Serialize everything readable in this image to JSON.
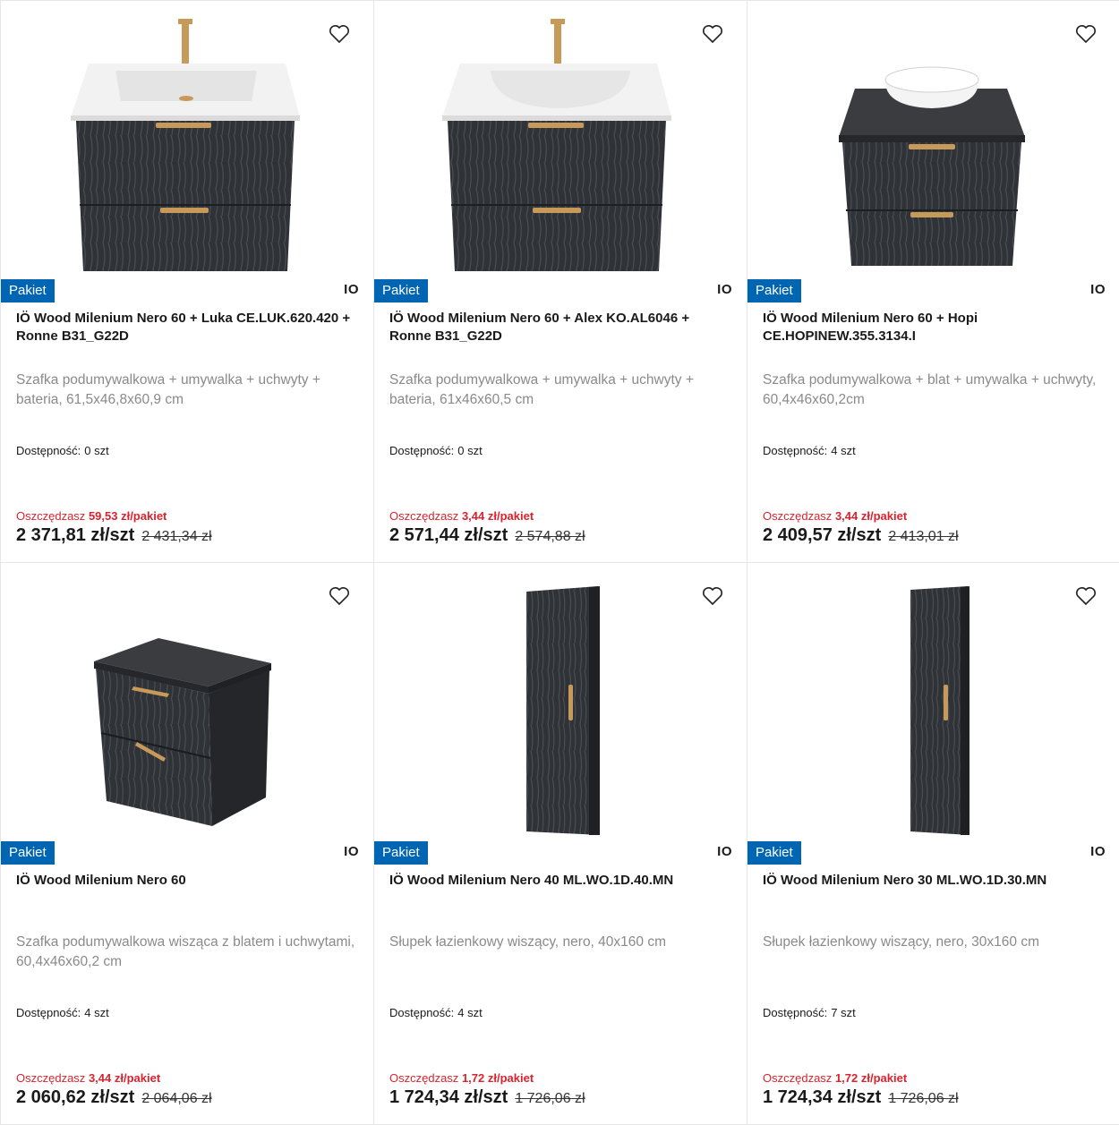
{
  "colors": {
    "badge": "#0066b3",
    "savings": "#d9232d",
    "cabinet": "#2f3236",
    "gold": "#c89a5a"
  },
  "products": [
    {
      "image": "vanity-sink-cabinet",
      "badge": "Pakiet",
      "brand": "IO",
      "title": "IÖ Wood Milenium Nero 60 + Luka CE.LUK.620.420 + Ronne B31_G22D",
      "description": "Szafka podumywalkowa + umywalka + uchwyty + bateria, 61,5x46,8x60,9 cm",
      "availability_label": "Dostępność:",
      "availability_value": "0 szt",
      "save_label": "Oszczędzasz",
      "save_value": "59,53 zł/pakiet",
      "price": "2 371,81 zł/szt",
      "old_price": "2 431,34 zł"
    },
    {
      "image": "vanity-sink-cabinet",
      "badge": "Pakiet",
      "brand": "IO",
      "title": "IÖ Wood Milenium Nero 60 + Alex KO.AL6046 + Ronne B31_G22D",
      "description": "Szafka podumywalkowa + umywalka + uchwyty + bateria, 61x46x60,5 cm",
      "availability_label": "Dostępność:",
      "availability_value": "0 szt",
      "save_label": "Oszczędzasz",
      "save_value": "3,44 zł/pakiet",
      "price": "2 571,44 zł/szt",
      "old_price": "2 574,88 zł"
    },
    {
      "image": "vanity-bowl-cabinet",
      "badge": "Pakiet",
      "brand": "IO",
      "title": "IÖ Wood Milenium Nero 60 + Hopi CE.HOPINEW.355.3134.I",
      "description": "Szafka podumywalkowa + blat + umywalka + uchwyty, 60,4x46x60,2cm",
      "availability_label": "Dostępność:",
      "availability_value": "4 szt",
      "save_label": "Oszczędzasz",
      "save_value": "3,44 zł/pakiet",
      "price": "2 409,57 zł/szt",
      "old_price": "2 413,01 zł"
    },
    {
      "image": "hanging-cabinet",
      "badge": "Pakiet",
      "brand": "IO",
      "title": "IÖ Wood Milenium Nero 60",
      "description": "Szafka podumywalkowa wisząca z blatem i uchwytami, 60,4x46x60,2 cm",
      "availability_label": "Dostępność:",
      "availability_value": "4 szt",
      "save_label": "Oszczędzasz",
      "save_value": "3,44 zł/pakiet",
      "price": "2 060,62 zł/szt",
      "old_price": "2 064,06 zł"
    },
    {
      "image": "tall-column",
      "badge": "Pakiet",
      "brand": "IO",
      "title": "IÖ Wood Milenium Nero 40 ML.WO.1D.40.MN",
      "description": "Słupek łazienkowy wiszący, nero, 40x160 cm",
      "availability_label": "Dostępność:",
      "availability_value": "4 szt",
      "save_label": "Oszczędzasz",
      "save_value": "1,72 zł/pakiet",
      "price": "1 724,34 zł/szt",
      "old_price": "1 726,06 zł"
    },
    {
      "image": "tall-column-narrow",
      "badge": "Pakiet",
      "brand": "IO",
      "title": "IÖ Wood Milenium Nero 30 ML.WO.1D.30.MN",
      "description": "Słupek łazienkowy wiszący, nero, 30x160 cm",
      "availability_label": "Dostępność:",
      "availability_value": "7 szt",
      "save_label": "Oszczędzasz",
      "save_value": "1,72 zł/pakiet",
      "price": "1 724,34 zł/szt",
      "old_price": "1 726,06 zł"
    }
  ]
}
